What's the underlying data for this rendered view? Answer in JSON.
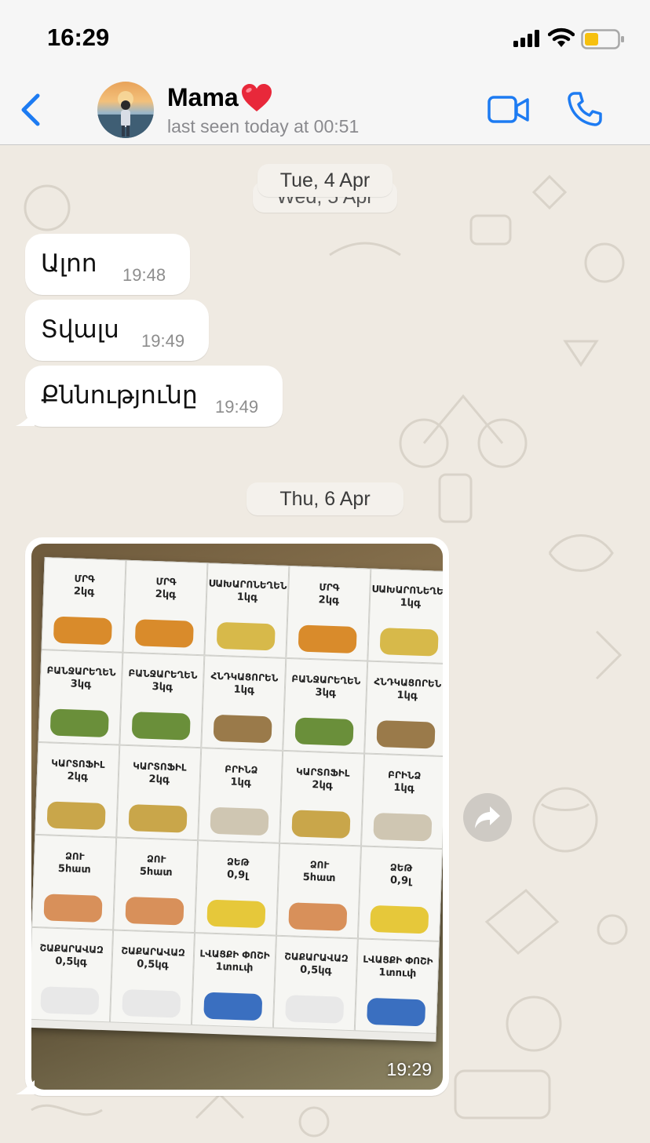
{
  "status_bar": {
    "time": "16:29"
  },
  "header": {
    "contact_name": "Mama",
    "last_seen": "last seen today at 00:51",
    "icons": [
      "back-chevron-icon",
      "red-heart-icon",
      "video-camera-icon",
      "phone-icon"
    ]
  },
  "chat": {
    "date_separator_1": "Tue, 4 Apr",
    "date_separator_1_hidden": "Wed, 5 Apr",
    "messages": [
      {
        "text": "Ալոո",
        "time": "19:48"
      },
      {
        "text": "Տվալս",
        "time": "19:49"
      },
      {
        "text": "Քննությունը",
        "time": "19:49"
      }
    ],
    "date_separator_2": "Thu, 6 Apr",
    "image_message": {
      "time": "19:29",
      "coupons": [
        {
          "name": "ՄՐԳ",
          "qty": "2կգ",
          "color": "#d98b2b"
        },
        {
          "name": "ՄՐԳ",
          "qty": "2կգ",
          "color": "#d98b2b"
        },
        {
          "name": "ՍԱԽԱՐՈՆԵՂԵՆ",
          "qty": "1կգ",
          "color": "#d7b94a"
        },
        {
          "name": "ՄՐԳ",
          "qty": "2կգ",
          "color": "#d98b2b"
        },
        {
          "name": "ՍԱԽԱՐՈՆԵՂԵՆ",
          "qty": "1կգ",
          "color": "#d7b94a"
        },
        {
          "name": "ԲԱՆՋԱՐԵՂԵՆ",
          "qty": "3կգ",
          "color": "#6a8f3a"
        },
        {
          "name": "ԲԱՆՋԱՐԵՂԵՆ",
          "qty": "3կգ",
          "color": "#6a8f3a"
        },
        {
          "name": "ՀՆԴԿԱՑՈՐԵՆ",
          "qty": "1կգ",
          "color": "#9a7a4a"
        },
        {
          "name": "ԲԱՆՋԱՐԵՂԵՆ",
          "qty": "3կգ",
          "color": "#6a8f3a"
        },
        {
          "name": "ՀՆԴԿԱՑՈՐԵՆ",
          "qty": "1կգ",
          "color": "#9a7a4a"
        },
        {
          "name": "ԿԱՐՏՈՖԻԼ",
          "qty": "2կգ",
          "color": "#c9a64a"
        },
        {
          "name": "ԿԱՐՏՈՖԻԼ",
          "qty": "2կգ",
          "color": "#c9a64a"
        },
        {
          "name": "ԲՐԻՆՁ",
          "qty": "1կգ",
          "color": "#cfc6b2"
        },
        {
          "name": "ԿԱՐՏՈՖԻԼ",
          "qty": "2կգ",
          "color": "#c9a64a"
        },
        {
          "name": "ԲՐԻՆՁ",
          "qty": "1կգ",
          "color": "#cfc6b2"
        },
        {
          "name": "ՁՈՒ",
          "qty": "5հատ",
          "color": "#d8905a"
        },
        {
          "name": "ՁՈՒ",
          "qty": "5հատ",
          "color": "#d8905a"
        },
        {
          "name": "ՁԵԹ",
          "qty": "0,9լ",
          "color": "#e6c83a"
        },
        {
          "name": "ՁՈՒ",
          "qty": "5հատ",
          "color": "#d8905a"
        },
        {
          "name": "ՁԵԹ",
          "qty": "0,9լ",
          "color": "#e6c83a"
        },
        {
          "name": "ՇԱՔԱՐԱՎԱԶ",
          "qty": "0,5կգ",
          "color": "#e8e8e8"
        },
        {
          "name": "ՇԱՔԱՐԱՎԱԶ",
          "qty": "0,5կգ",
          "color": "#e8e8e8"
        },
        {
          "name": "ԼՎԱՑՔԻ ՓՈՇԻ",
          "qty": "1տուփ",
          "color": "#3a6fc0"
        },
        {
          "name": "ՇԱՔԱՐԱՎԱԶ",
          "qty": "0,5կգ",
          "color": "#e8e8e8"
        },
        {
          "name": "ԼՎԱՑՔԻ ՓՈՇԻ",
          "qty": "1տուփ",
          "color": "#3a6fc0"
        }
      ]
    },
    "forward_icon": "share-arrow-icon"
  },
  "colors": {
    "accent": "#1d7bf2",
    "bubble": "#ffffff",
    "wallpaper": "#efeae2"
  }
}
